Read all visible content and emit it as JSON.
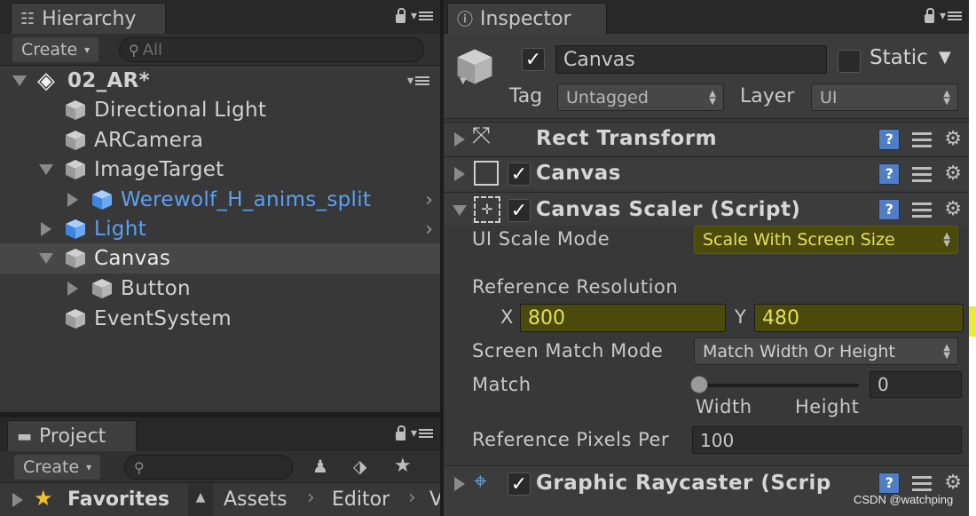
{
  "hierarchy": {
    "tab_label": "Hierarchy",
    "create_label": "Create",
    "search_placeholder": "All",
    "scene_name": "02_AR*",
    "items": [
      {
        "label": "Directional Light"
      },
      {
        "label": "ARCamera"
      },
      {
        "label": "ImageTarget"
      },
      {
        "label": "Werewolf_H_anims_split"
      },
      {
        "label": "Light"
      },
      {
        "label": "Canvas"
      },
      {
        "label": "Button"
      },
      {
        "label": "EventSystem"
      }
    ]
  },
  "project": {
    "tab_label": "Project",
    "create_label": "Create",
    "favorites_label": "Favorites",
    "breadcrumb": [
      "Assets",
      "Editor",
      "V"
    ]
  },
  "inspector": {
    "tab_label": "Inspector",
    "object_name": "Canvas",
    "static_label": "Static",
    "tag_label": "Tag",
    "tag_value": "Untagged",
    "layer_label": "Layer",
    "layer_value": "UI",
    "components": {
      "rect_transform": "Rect Transform",
      "canvas": "Canvas",
      "canvas_scaler": "Canvas Scaler (Script)",
      "graphic_raycaster": "Graphic Raycaster (Scrip"
    },
    "scaler": {
      "ui_scale_mode_label": "UI Scale Mode",
      "ui_scale_mode_value": "Scale With Screen Size",
      "reference_resolution_label": "Reference Resolution",
      "x_label": "X",
      "x_value": "800",
      "y_label": "Y",
      "y_value": "480",
      "screen_match_mode_label": "Screen Match Mode",
      "screen_match_mode_value": "Match Width Or Height",
      "match_label": "Match",
      "match_value": "0",
      "width_label": "Width",
      "height_label": "Height",
      "ref_pixels_label": "Reference Pixels Per",
      "ref_pixels_value": "100"
    }
  },
  "watermark": "CSDN @watchping",
  "colors": {
    "panel_bg": "#383838",
    "highlight": "#4a4a0a",
    "highlight_text": "#e0e060",
    "prefab_blue": "#5aa0f5"
  }
}
